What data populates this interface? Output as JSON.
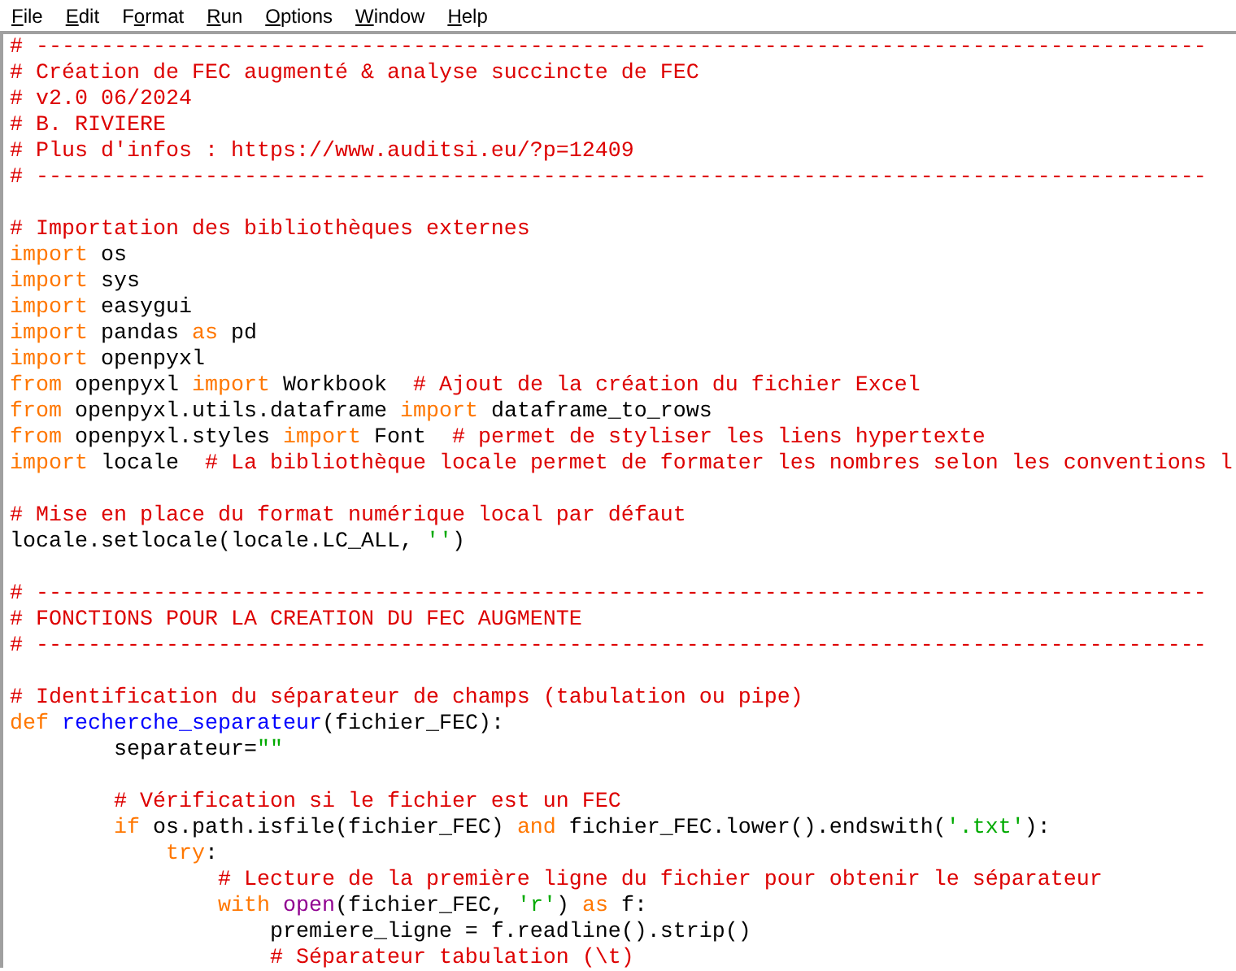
{
  "menu": [
    {
      "parts": [
        {
          "text": "F",
          "underlined": true
        },
        {
          "text": "ile",
          "underlined": false
        }
      ]
    },
    {
      "parts": [
        {
          "text": "E",
          "underlined": true
        },
        {
          "text": "dit",
          "underlined": false
        }
      ]
    },
    {
      "parts": [
        {
          "text": "F",
          "underlined": false
        },
        {
          "text": "o",
          "underlined": true
        },
        {
          "text": "rmat",
          "underlined": false
        }
      ]
    },
    {
      "parts": [
        {
          "text": "R",
          "underlined": true
        },
        {
          "text": "un",
          "underlined": false
        }
      ]
    },
    {
      "parts": [
        {
          "text": "O",
          "underlined": true
        },
        {
          "text": "ptions",
          "underlined": false
        }
      ]
    },
    {
      "parts": [
        {
          "text": "W",
          "underlined": true
        },
        {
          "text": "indow",
          "underlined": false
        }
      ]
    },
    {
      "parts": [
        {
          "text": "H",
          "underlined": true
        },
        {
          "text": "elp",
          "underlined": false
        }
      ]
    }
  ],
  "editor": {
    "lines": [
      {
        "tokens": [
          {
            "kind": "comment",
            "text": "# ------------------------------------------------------------------------------------------"
          }
        ]
      },
      {
        "tokens": [
          {
            "kind": "comment",
            "text": "# Création de FEC augmenté & analyse succincte de FEC"
          }
        ]
      },
      {
        "tokens": [
          {
            "kind": "comment",
            "text": "# v2.0 06/2024"
          }
        ]
      },
      {
        "tokens": [
          {
            "kind": "comment",
            "text": "# B. RIVIERE"
          }
        ]
      },
      {
        "tokens": [
          {
            "kind": "comment",
            "text": "# Plus d'infos : https://www.auditsi.eu/?p=12409"
          }
        ]
      },
      {
        "tokens": [
          {
            "kind": "comment",
            "text": "# ------------------------------------------------------------------------------------------"
          }
        ]
      },
      {
        "gap_before": true,
        "tokens": [
          {
            "kind": "comment",
            "text": "# Importation des bibliothèques externes"
          }
        ]
      },
      {
        "tokens": [
          {
            "kind": "keyword",
            "text": "import"
          },
          {
            "kind": "plain",
            "text": " os"
          }
        ]
      },
      {
        "tokens": [
          {
            "kind": "keyword",
            "text": "import"
          },
          {
            "kind": "plain",
            "text": " sys"
          }
        ]
      },
      {
        "tokens": [
          {
            "kind": "keyword",
            "text": "import"
          },
          {
            "kind": "plain",
            "text": " easygui"
          }
        ]
      },
      {
        "tokens": [
          {
            "kind": "keyword",
            "text": "import"
          },
          {
            "kind": "plain",
            "text": " pandas "
          },
          {
            "kind": "keyword",
            "text": "as"
          },
          {
            "kind": "plain",
            "text": " pd"
          }
        ]
      },
      {
        "tokens": [
          {
            "kind": "keyword",
            "text": "import"
          },
          {
            "kind": "plain",
            "text": " openpyxl"
          }
        ]
      },
      {
        "tokens": [
          {
            "kind": "keyword",
            "text": "from"
          },
          {
            "kind": "plain",
            "text": " openpyxl "
          },
          {
            "kind": "keyword",
            "text": "import"
          },
          {
            "kind": "plain",
            "text": " Workbook  "
          },
          {
            "kind": "comment",
            "text": "# Ajout de la création du fichier Excel"
          }
        ]
      },
      {
        "tokens": [
          {
            "kind": "keyword",
            "text": "from"
          },
          {
            "kind": "plain",
            "text": " openpyxl.utils.dataframe "
          },
          {
            "kind": "keyword",
            "text": "import"
          },
          {
            "kind": "plain",
            "text": " dataframe_to_rows"
          }
        ]
      },
      {
        "tokens": [
          {
            "kind": "keyword",
            "text": "from"
          },
          {
            "kind": "plain",
            "text": " openpyxl.styles "
          },
          {
            "kind": "keyword",
            "text": "import"
          },
          {
            "kind": "plain",
            "text": " Font  "
          },
          {
            "kind": "comment",
            "text": "# permet de styliser les liens hypertexte"
          }
        ]
      },
      {
        "tokens": [
          {
            "kind": "keyword",
            "text": "import"
          },
          {
            "kind": "plain",
            "text": " locale  "
          },
          {
            "kind": "comment",
            "text": "# La bibliothèque locale permet de formater les nombres selon les conventions l"
          }
        ]
      },
      {
        "gap_before": true,
        "tokens": [
          {
            "kind": "comment",
            "text": "# Mise en place du format numérique local par défaut"
          }
        ]
      },
      {
        "tokens": [
          {
            "kind": "plain",
            "text": "locale.setlocale(locale.LC_ALL, "
          },
          {
            "kind": "string",
            "text": "''"
          },
          {
            "kind": "plain",
            "text": ")"
          }
        ]
      },
      {
        "gap_before": true,
        "tokens": [
          {
            "kind": "comment",
            "text": "# ------------------------------------------------------------------------------------------"
          }
        ]
      },
      {
        "tokens": [
          {
            "kind": "comment",
            "text": "# FONCTIONS POUR LA CREATION DU FEC AUGMENTE"
          }
        ]
      },
      {
        "tokens": [
          {
            "kind": "comment",
            "text": "# ------------------------------------------------------------------------------------------"
          }
        ]
      },
      {
        "gap_before": true,
        "tokens": [
          {
            "kind": "comment",
            "text": "# Identification du séparateur de champs (tabulation ou pipe)"
          }
        ]
      },
      {
        "tokens": [
          {
            "kind": "keyword",
            "text": "def "
          },
          {
            "kind": "definition",
            "text": "recherche_separateur"
          },
          {
            "kind": "plain",
            "text": "(fichier_FEC):"
          }
        ]
      },
      {
        "tokens": [
          {
            "kind": "plain",
            "text": "        separateur="
          },
          {
            "kind": "string",
            "text": "\"\""
          }
        ]
      },
      {
        "gap_before": true,
        "tokens": [
          {
            "kind": "comment",
            "text": "        # Vérification si le fichier est un FEC"
          }
        ]
      },
      {
        "tokens": [
          {
            "kind": "keyword",
            "text": "        if"
          },
          {
            "kind": "plain",
            "text": " os.path.isfile(fichier_FEC) "
          },
          {
            "kind": "keyword",
            "text": "and"
          },
          {
            "kind": "plain",
            "text": " fichier_FEC.lower().endswith("
          },
          {
            "kind": "string",
            "text": "'.txt'"
          },
          {
            "kind": "plain",
            "text": "):"
          }
        ]
      },
      {
        "tokens": [
          {
            "kind": "keyword",
            "text": "            try"
          },
          {
            "kind": "plain",
            "text": ":"
          }
        ]
      },
      {
        "tokens": [
          {
            "kind": "comment",
            "text": "                # Lecture de la première ligne du fichier pour obtenir le séparateur"
          }
        ]
      },
      {
        "tokens": [
          {
            "kind": "keyword",
            "text": "                with "
          },
          {
            "kind": "builtin",
            "text": "open"
          },
          {
            "kind": "plain",
            "text": "(fichier_FEC, "
          },
          {
            "kind": "string",
            "text": "'r'"
          },
          {
            "kind": "plain",
            "text": ") "
          },
          {
            "kind": "keyword",
            "text": "as"
          },
          {
            "kind": "plain",
            "text": " f:"
          }
        ]
      },
      {
        "tokens": [
          {
            "kind": "plain",
            "text": "                    premiere_ligne = f.readline().strip()"
          }
        ]
      },
      {
        "tokens": [
          {
            "kind": "comment",
            "text": "                    # Séparateur tabulation (\\t)"
          }
        ]
      }
    ]
  }
}
